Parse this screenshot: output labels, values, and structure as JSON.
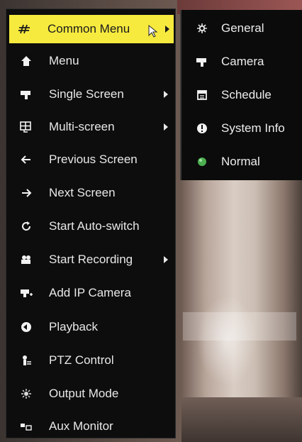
{
  "main_menu": {
    "items": [
      {
        "label": "Common Menu",
        "icon": "common-menu-icon",
        "submenu": true,
        "active": true
      },
      {
        "label": "Menu",
        "icon": "home-icon",
        "submenu": false
      },
      {
        "label": "Single Screen",
        "icon": "camera-icon",
        "submenu": true
      },
      {
        "label": "Multi-screen",
        "icon": "multiscreen-icon",
        "submenu": true
      },
      {
        "label": "Previous Screen",
        "icon": "arrow-left-icon",
        "submenu": false
      },
      {
        "label": "Next Screen",
        "icon": "arrow-right-icon",
        "submenu": false
      },
      {
        "label": "Start Auto-switch",
        "icon": "refresh-icon",
        "submenu": false
      },
      {
        "label": "Start Recording",
        "icon": "recording-icon",
        "submenu": true
      },
      {
        "label": "Add IP Camera",
        "icon": "add-ip-camera-icon",
        "submenu": false
      },
      {
        "label": "Playback",
        "icon": "playback-icon",
        "submenu": false
      },
      {
        "label": "PTZ Control",
        "icon": "ptz-icon",
        "submenu": false
      },
      {
        "label": "Output Mode",
        "icon": "output-mode-icon",
        "submenu": false
      },
      {
        "label": "Aux Monitor",
        "icon": "aux-monitor-icon",
        "submenu": false
      }
    ]
  },
  "sub_menu": {
    "items": [
      {
        "label": "General",
        "icon": "gear-icon"
      },
      {
        "label": "Camera",
        "icon": "camera-icon"
      },
      {
        "label": "Schedule",
        "icon": "calendar-icon"
      },
      {
        "label": "System Info",
        "icon": "info-icon"
      },
      {
        "label": "Normal",
        "icon": "status-dot-icon",
        "status_color": "#4caf50"
      }
    ]
  },
  "colors": {
    "highlight": "#f6ea3f",
    "menu_bg": "#0d0d0d",
    "text": "#e8e8e8"
  }
}
